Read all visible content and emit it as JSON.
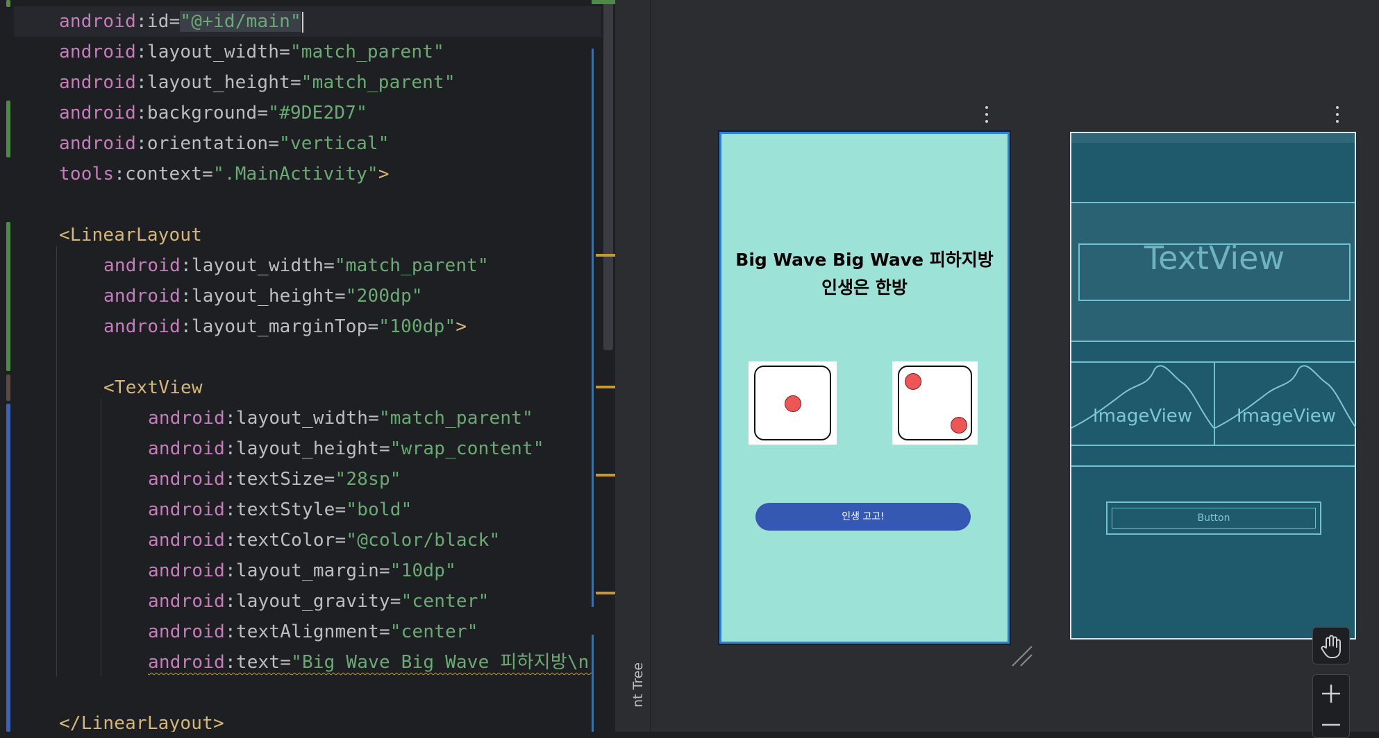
{
  "editor": {
    "lines": [
      {
        "ns": "android",
        "attr": "id",
        "value": "\"@+id/main\""
      },
      {
        "ns": "android",
        "attr": "layout_width",
        "value": "\"match_parent\""
      },
      {
        "ns": "android",
        "attr": "layout_height",
        "value": "\"match_parent\""
      },
      {
        "ns": "android",
        "attr": "background",
        "value": "\"#9DE2D7\""
      },
      {
        "ns": "android",
        "attr": "orientation",
        "value": "\"vertical\""
      },
      {
        "ns": "tools",
        "attr": "context",
        "value": "\".MainActivity\"",
        "close": ">"
      },
      {
        "tag_open": "<LinearLayout"
      },
      {
        "ns": "android",
        "attr": "layout_width",
        "value": "\"match_parent\""
      },
      {
        "ns": "android",
        "attr": "layout_height",
        "value": "\"200dp\""
      },
      {
        "ns": "android",
        "attr": "layout_marginTop",
        "value": "\"100dp\"",
        "close": ">"
      },
      {
        "tag_open": "<TextView"
      },
      {
        "ns": "android",
        "attr": "layout_width",
        "value": "\"match_parent\""
      },
      {
        "ns": "android",
        "attr": "layout_height",
        "value": "\"wrap_content\""
      },
      {
        "ns": "android",
        "attr": "textSize",
        "value": "\"28sp\""
      },
      {
        "ns": "android",
        "attr": "textStyle",
        "value": "\"bold\""
      },
      {
        "ns": "android",
        "attr": "textColor",
        "value": "\"@color/black\""
      },
      {
        "ns": "android",
        "attr": "layout_margin",
        "value": "\"10dp\""
      },
      {
        "ns": "android",
        "attr": "layout_gravity",
        "value": "\"center\""
      },
      {
        "ns": "android",
        "attr": "textAlignment",
        "value": "\"center\""
      },
      {
        "ns": "android",
        "attr": "text",
        "value": "\"Big Wave Big Wave 피하지방\\n 인"
      },
      {
        "tag_close": "</LinearLayout>"
      }
    ]
  },
  "design": {
    "side_label": "nt Tree",
    "preview": {
      "title_line1": "Big Wave Big Wave 피하지방",
      "title_line2": "인생은 한방",
      "button_label": "인생 고고!"
    },
    "blueprint": {
      "textview_label": "TextView",
      "imageview1_label": "ImageView",
      "imageview2_label": "ImageView",
      "button_label": "Button"
    }
  },
  "colors": {
    "preview_background": "#9DE2D7",
    "button": "#3558B2",
    "pip": "#EE5555",
    "blueprint_background": "#1F5A6C"
  }
}
